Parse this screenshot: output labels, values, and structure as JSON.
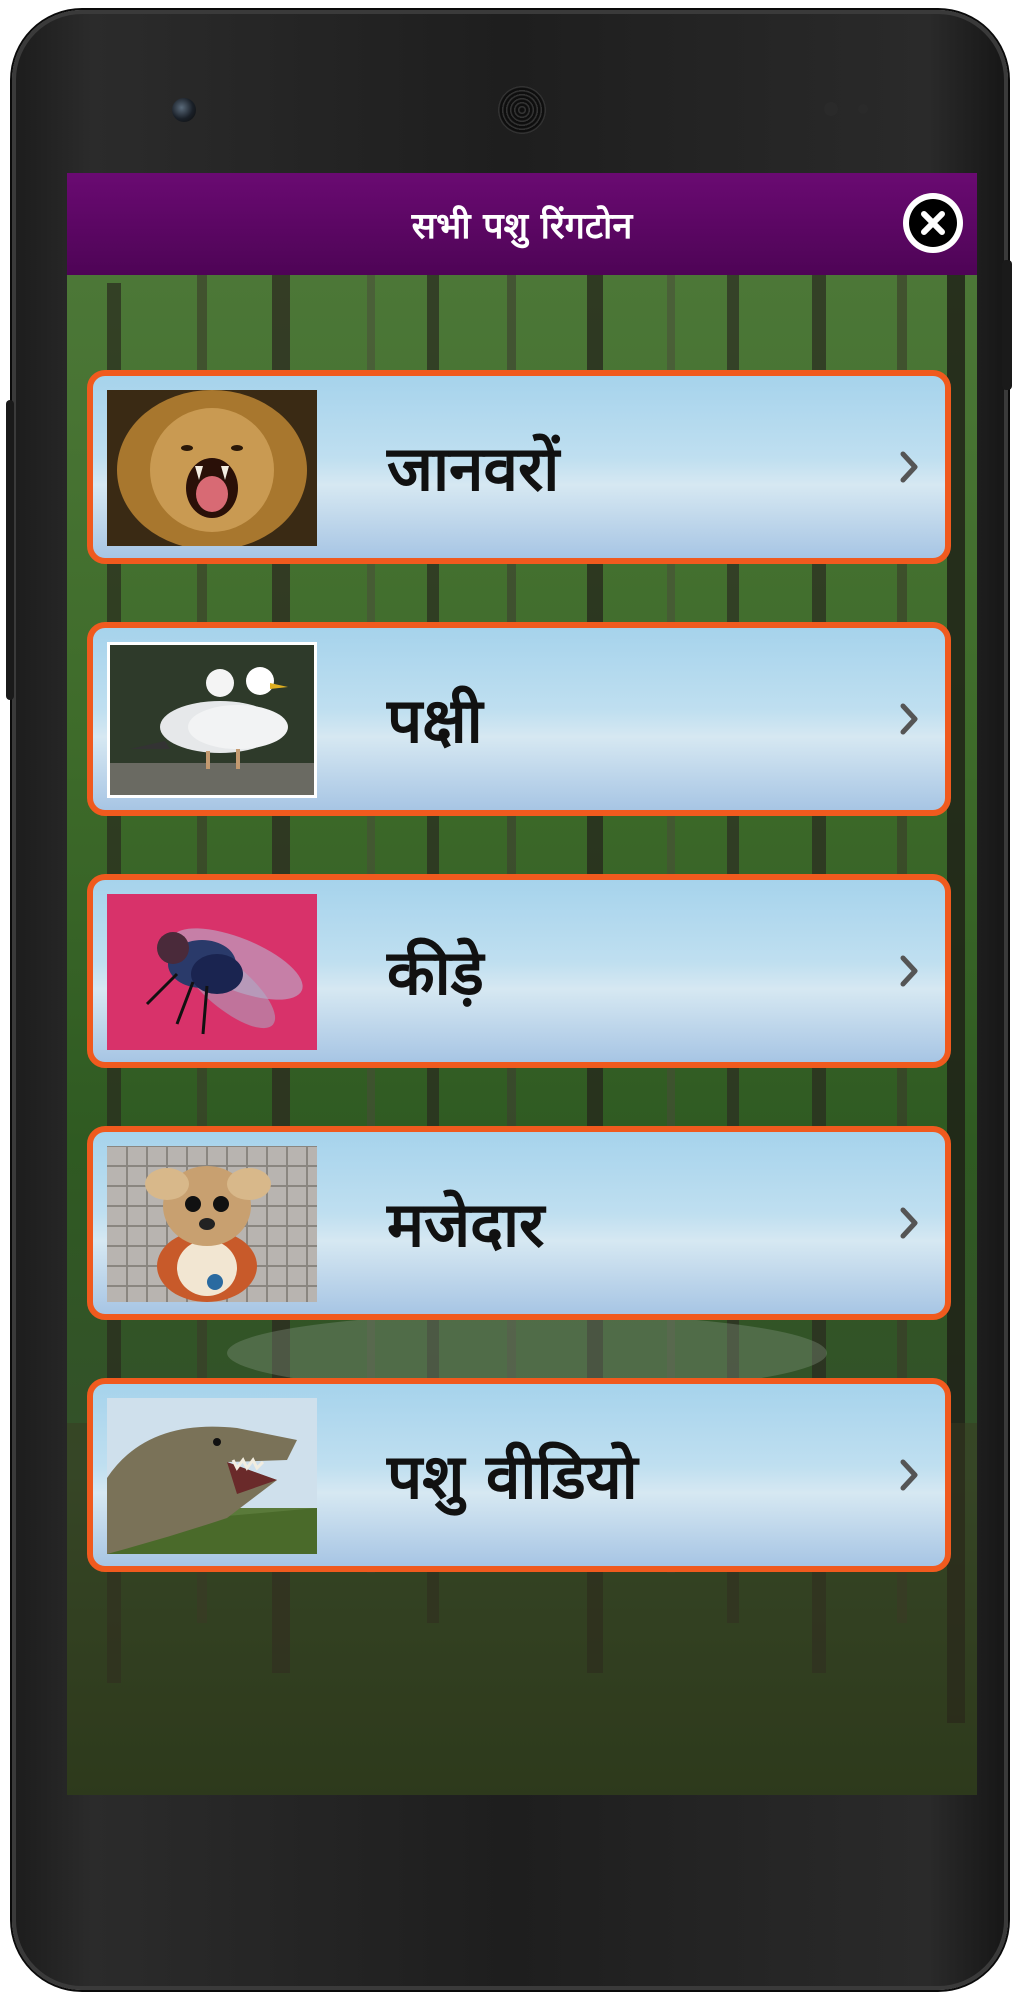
{
  "app": {
    "title": "सभी पशु रिंगटोन"
  },
  "header": {
    "close_icon": "close-icon"
  },
  "menu": {
    "items": [
      {
        "label": "जानवरों",
        "thumbnail": "lion-image",
        "chevron": "chevron-right-icon"
      },
      {
        "label": "पक्षी",
        "thumbnail": "seagulls-image",
        "chevron": "chevron-right-icon"
      },
      {
        "label": "कीड़े",
        "thumbnail": "fly-image",
        "chevron": "chevron-right-icon"
      },
      {
        "label": "मजेदार",
        "thumbnail": "dog-costume-image",
        "chevron": "chevron-right-icon"
      },
      {
        "label": "पशु वीडियो",
        "thumbnail": "dinosaur-image",
        "chevron": "chevron-right-icon"
      }
    ]
  },
  "colors": {
    "titlebar": "#5e0866",
    "item_border": "#f05a1e",
    "item_background": "#b8dcef",
    "label_text": "#111111"
  }
}
